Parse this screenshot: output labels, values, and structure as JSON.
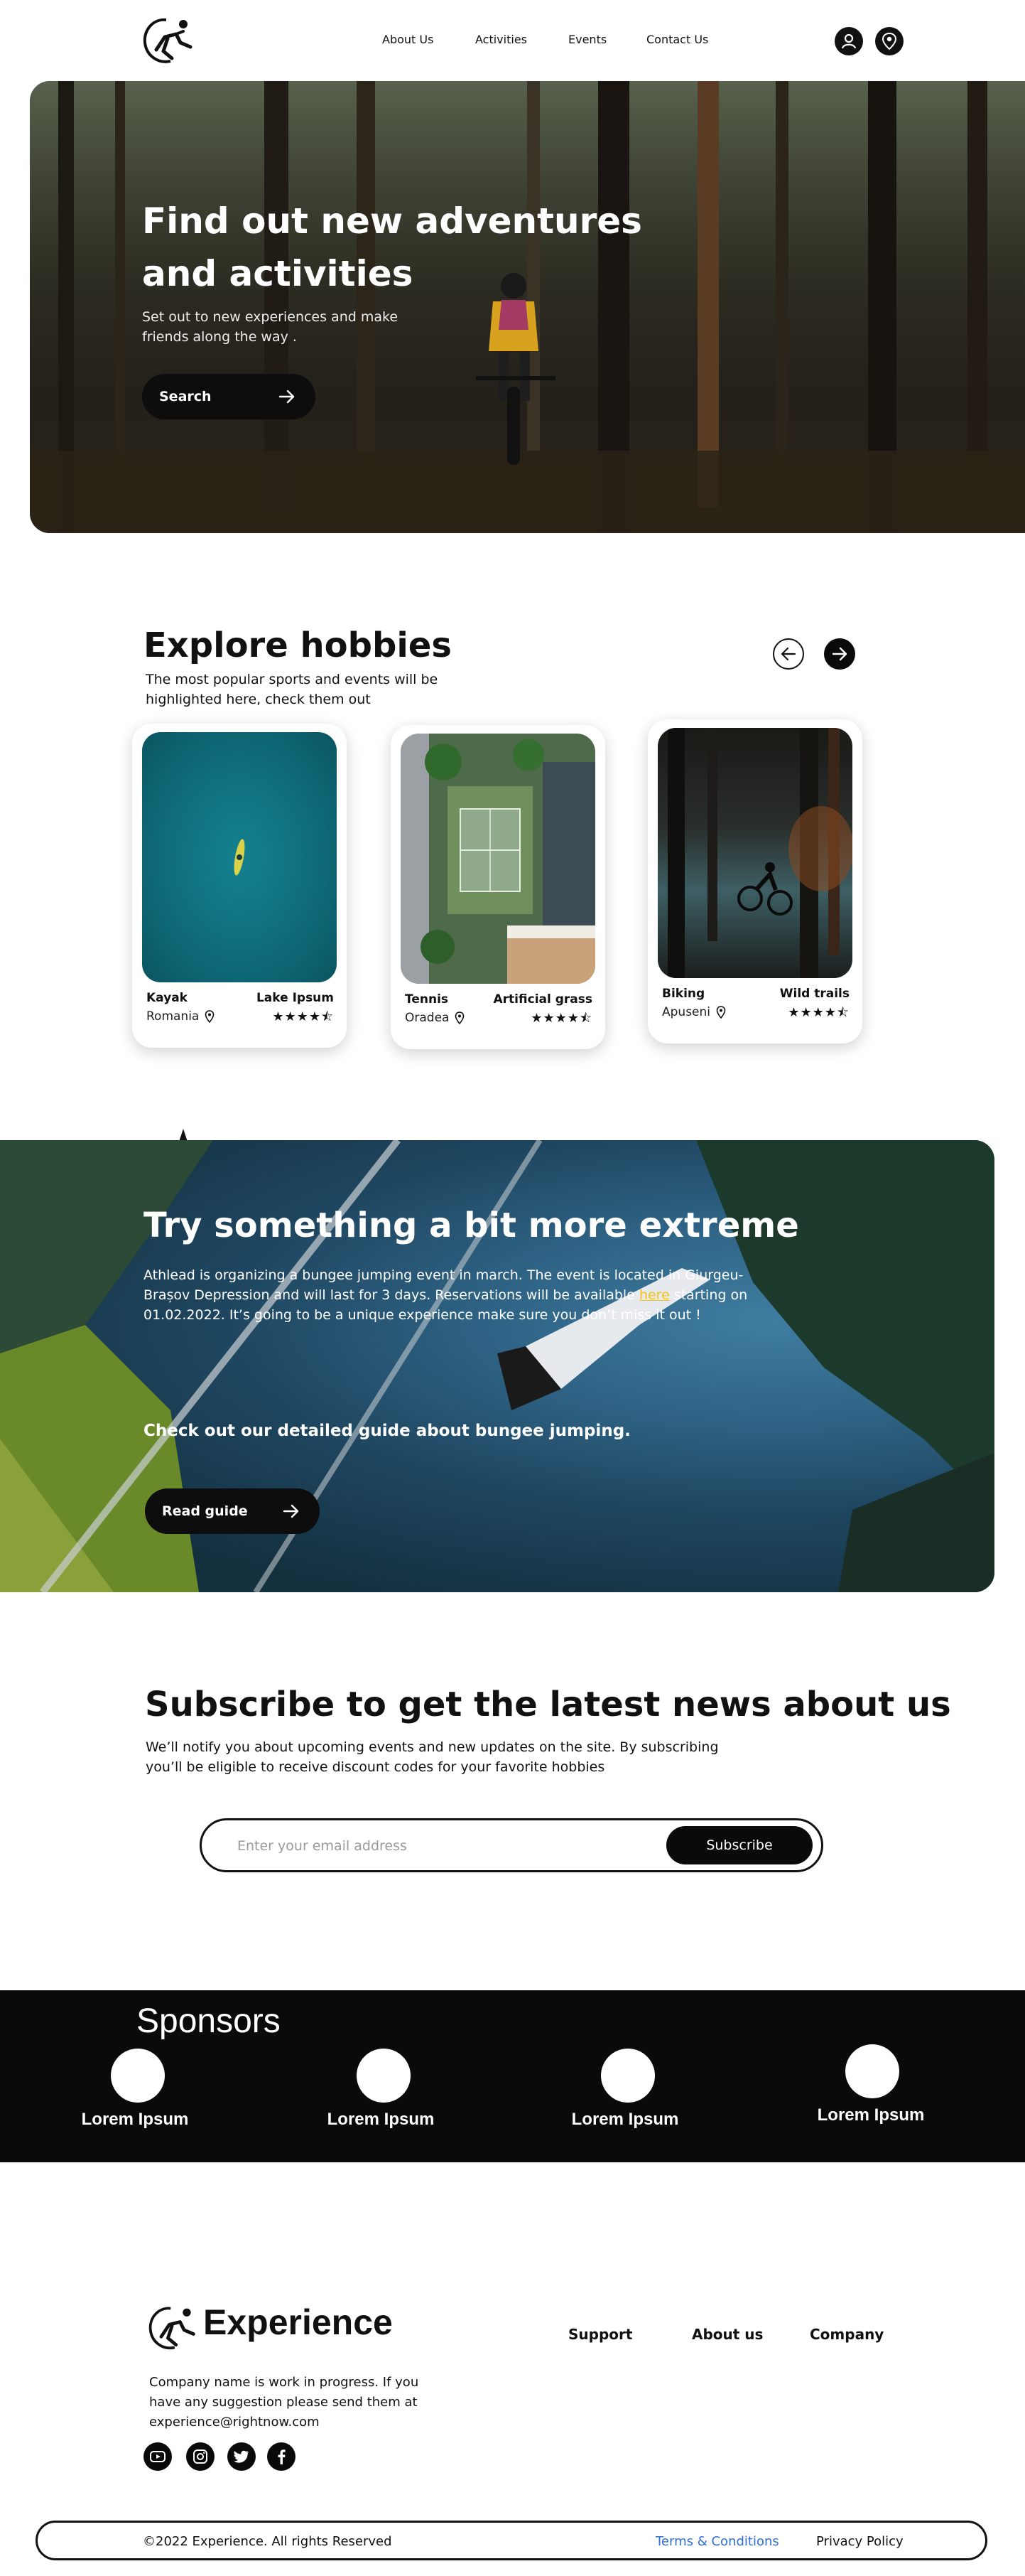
{
  "nav": {
    "links": [
      "About Us",
      "Activities",
      "Events",
      "Contact Us"
    ],
    "icons": [
      "user-icon",
      "location-pin-icon"
    ]
  },
  "hero": {
    "title": "Find out new adventures and activities",
    "subtitle": "Set out to new experiences and make friends along the way .",
    "search_label": "Search"
  },
  "explore": {
    "title": "Explore hobbies",
    "subtitle": "The most popular sports and events will be highlighted here, check them out",
    "cards": [
      {
        "name": "Kayak",
        "tag": "Lake Ipsum",
        "location": "Romania",
        "rating": 4.5
      },
      {
        "name": "Tennis",
        "tag": "Artificial grass",
        "location": "Oradea",
        "rating": 4.5
      },
      {
        "name": "Biking",
        "tag": "Wild trails",
        "location": "Apuseni",
        "rating": 4.5
      }
    ],
    "stars_text": "★★★★⯪"
  },
  "extreme": {
    "title": "Try something a bit more extreme",
    "body_before": "Athlead is organizing a bungee jumping event in march. The event is located in Giurgeu-Brașov Depression and will last for 3 days. Reservations will be available ",
    "link": "here",
    "body_after": " starting on 01.02.2022. It’s going to be a unique experience make sure you don’t miss it out !",
    "guide_text": "Check out our detailed guide about bungee jumping.",
    "button_label": "Read guide"
  },
  "subscribe": {
    "title": "Subscribe to get the latest news about us",
    "text": "We’ll notify you about upcoming events and new updates on the site. By subscribing you’ll be eligible to receive discount codes for your favorite hobbies",
    "placeholder": "Enter your email address",
    "button_label": "Subscribe"
  },
  "sponsors": {
    "title": "Sponsors",
    "items": [
      "Lorem Ipsum",
      "Lorem Ipsum",
      "Lorem Ipsum",
      "Lorem Ipsum"
    ]
  },
  "footer": {
    "brand": "Experience",
    "columns": [
      "Support",
      "About us",
      "Company"
    ],
    "description": "Company name is work in progress. If you have any suggestion please send them at experience@rightnow.com",
    "socials": [
      "youtube-icon",
      "instagram-icon",
      "twitter-icon",
      "facebook-icon"
    ],
    "copyright": "©2022 Experience.  All rights Reserved",
    "terms": "Terms & Conditions",
    "privacy": "Privacy Policy"
  },
  "colors": {
    "dark": "#0a0a0a",
    "link_yellow": "#f5c518",
    "terms_blue": "#2f6fd6",
    "kayak_water": "#0f6a78"
  }
}
